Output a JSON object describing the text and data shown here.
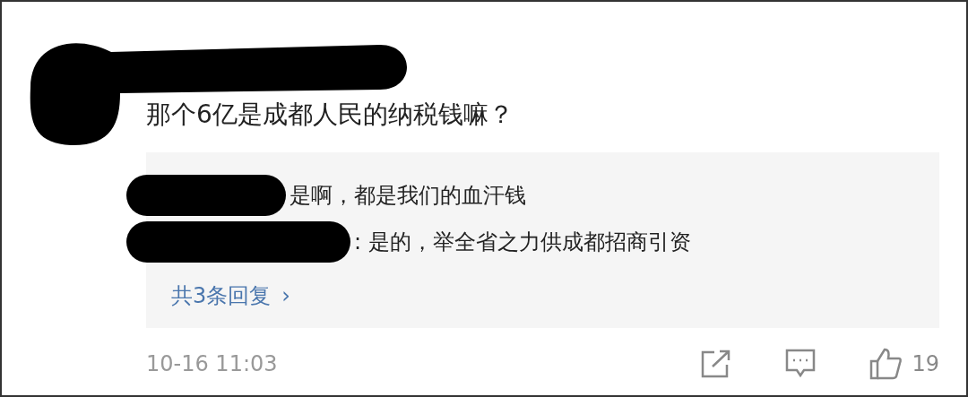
{
  "comment": {
    "text": "那个6亿是成都人民的纳税钱嘛？"
  },
  "replies": [
    {
      "text": "是啊，都是我们的血汗钱"
    },
    {
      "text": ": 是的，举全省之力供成都招商引资"
    }
  ],
  "more_replies": {
    "label": "共3条回复",
    "chevron": "›"
  },
  "footer": {
    "time": "10-16 11:03",
    "likes": "19"
  }
}
